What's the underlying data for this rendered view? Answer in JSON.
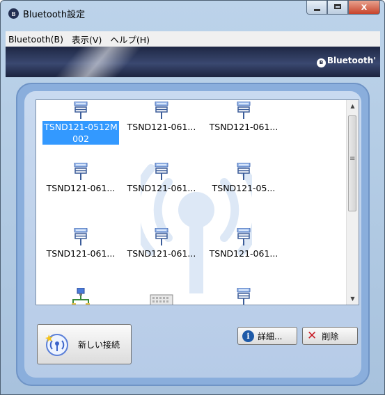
{
  "window": {
    "title": "Bluetooth設定",
    "app_icon": "bluetooth-icon",
    "close_glyph": "x"
  },
  "menu": [
    "Bluetooth(B)",
    "表示(V)",
    "ヘルプ(H)"
  ],
  "banner": {
    "brand": "Bluetooth",
    "brand_suffix": "'"
  },
  "devices": [
    {
      "label": "TSND121-0512M002",
      "icon": "serial-port-device-icon",
      "selected": true
    },
    {
      "label": "TSND121-061...",
      "icon": "serial-port-device-icon",
      "selected": false
    },
    {
      "label": "TSND121-061...",
      "icon": "serial-port-device-icon",
      "selected": false
    },
    {
      "label": "TSND121-061...",
      "icon": "serial-port-device-icon",
      "selected": false
    },
    {
      "label": "TSND121-061...",
      "icon": "serial-port-device-icon",
      "selected": false
    },
    {
      "label": "TSND121-05...",
      "icon": "serial-port-device-icon",
      "selected": false
    },
    {
      "label": "TSND121-061...",
      "icon": "serial-port-device-icon",
      "selected": false
    },
    {
      "label": "TSND121-061...",
      "icon": "serial-port-device-icon",
      "selected": false
    },
    {
      "label": "TSND121-061...",
      "icon": "serial-port-device-icon",
      "selected": false
    },
    {
      "label": "",
      "icon": "network-device-icon",
      "selected": false
    },
    {
      "label": "",
      "icon": "keyboard-device-icon",
      "selected": false
    },
    {
      "label": "",
      "icon": "serial-port-device-icon",
      "selected": false
    }
  ],
  "buttons": {
    "new_connection": "新しい接続",
    "details": "詳細...",
    "delete": "削除"
  },
  "colors": {
    "selection": "#3399ff",
    "banner": "#1e2744",
    "panel": "#8aaedc"
  }
}
